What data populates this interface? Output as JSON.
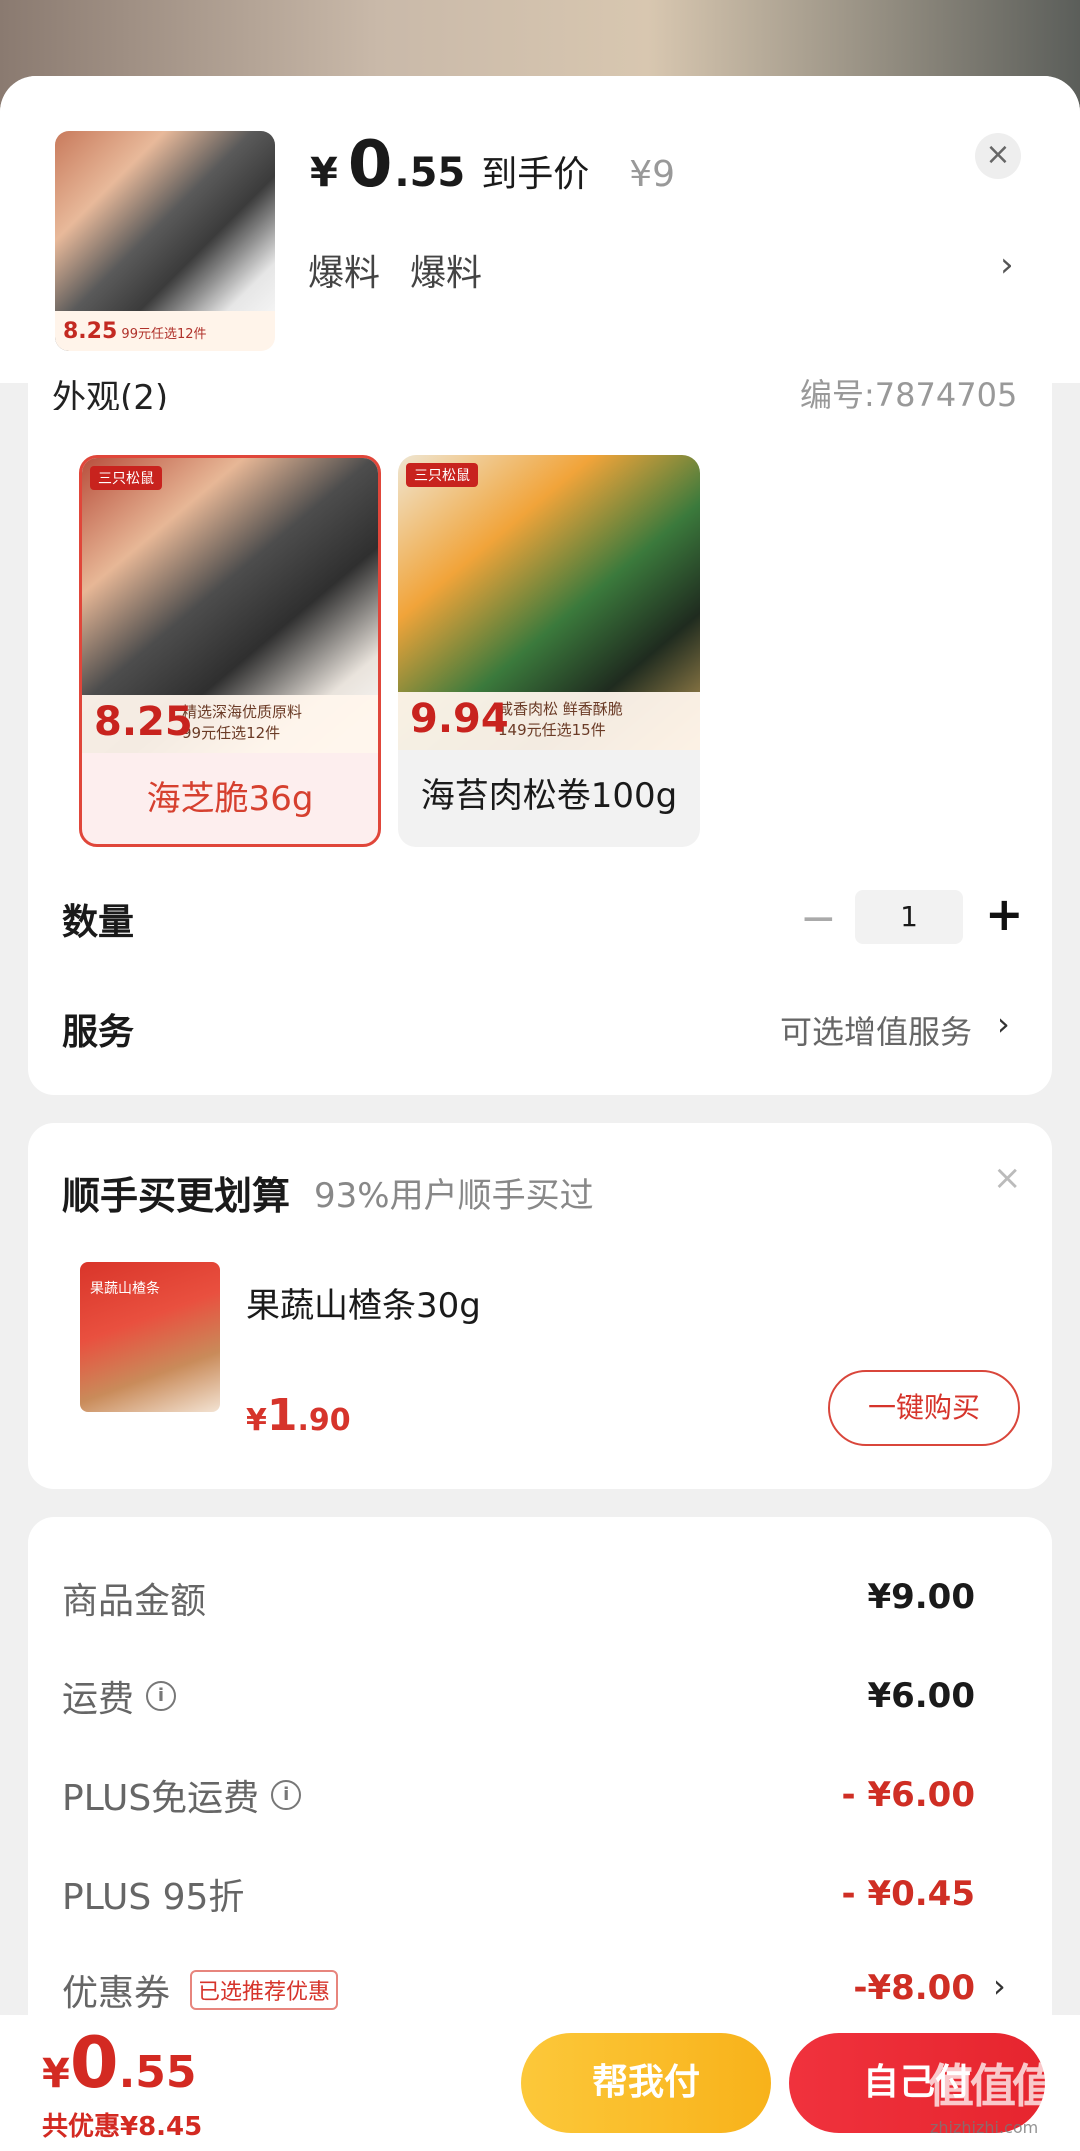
{
  "header": {
    "price_symbol": "¥",
    "price_int": "0",
    "price_dec": ".55",
    "price_label": "到手价",
    "orig_price": "¥9",
    "tags": [
      "爆料",
      "爆料"
    ],
    "close_glyph": "×",
    "chevron_glyph": "›",
    "thumb_price": "8.25",
    "thumb_tag": "99元任选12件"
  },
  "spec": {
    "title": "外观(2)",
    "code": "编号:7874705",
    "options": [
      {
        "name": "海芝脆36g",
        "brand": "三只松鼠",
        "price": "8.25",
        "tag1": "精选深海优质原料",
        "tag2": "99元任选12件",
        "selected": true
      },
      {
        "name": "海苔肉松卷100g",
        "brand": "三只松鼠",
        "price": "9.94",
        "tag1": "咸香肉松 鲜香酥脆",
        "tag2": "149元任选15件",
        "selected": false
      }
    ]
  },
  "quantity": {
    "label": "数量",
    "minus_glyph": "−",
    "value": "1",
    "plus_glyph": "+"
  },
  "service": {
    "label": "服务",
    "value": "可选增值服务",
    "chevron_glyph": "›"
  },
  "addon": {
    "title": "顺手买更划算",
    "subtitle": "93%用户顺手买过",
    "close_glyph": "×",
    "product_name": "果蔬山楂条30g",
    "img_text": "果蔬山楂条",
    "price_symbol": "¥",
    "price_int": "1",
    "price_dec": ".90",
    "button_label": "一键购买"
  },
  "pricing": {
    "rows": [
      {
        "label": "商品金额",
        "value": "¥9.00"
      },
      {
        "label": "运费",
        "value": "¥6.00"
      },
      {
        "label": "PLUS免运费",
        "value": "- ¥6.00"
      },
      {
        "label": "PLUS 95折",
        "value": "- ¥0.45"
      },
      {
        "label": "优惠券",
        "value": "-¥8.00"
      }
    ],
    "coupon_badge": "已选推荐优惠",
    "info_glyph": "i",
    "chevron_glyph": "›"
  },
  "bottom": {
    "total_symbol": "¥",
    "total_int": "0",
    "total_dec": ".55",
    "savings": "共优惠¥8.45",
    "help_pay_label": "帮我付",
    "self_pay_label": "自己付",
    "watermark": "值值值",
    "watermark_url": "zhizhizhi.com"
  },
  "colors": {
    "accent_red": "#d6342b",
    "help_btn": "#f8b21a",
    "self_btn": "#e6252e"
  }
}
